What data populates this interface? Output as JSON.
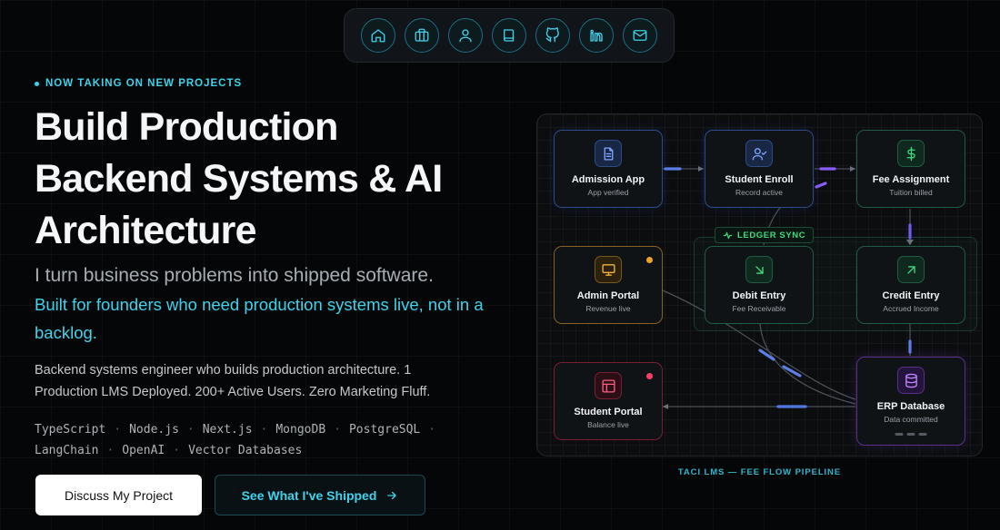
{
  "nav": {
    "items": [
      {
        "name": "home-icon"
      },
      {
        "name": "briefcase-icon"
      },
      {
        "name": "user-icon"
      },
      {
        "name": "book-icon"
      },
      {
        "name": "github-icon"
      },
      {
        "name": "linkedin-icon"
      },
      {
        "name": "mail-icon"
      }
    ]
  },
  "hero": {
    "eyebrow": "NOW TAKING ON NEW PROJECTS",
    "title_line1": "Build Production",
    "title_line2": "Backend Systems & AI",
    "title_line3": "Architecture",
    "subhead": "I turn business problems into shipped software.",
    "subhead_accent": "Built for founders who need production systems live, not in a backlog.",
    "description": "Backend systems engineer who builds production architecture. 1 Production LMS Deployed. 200+ Active Users. Zero Marketing Fluff.",
    "stack": [
      "TypeScript",
      "Node.js",
      "Next.js",
      "MongoDB",
      "PostgreSQL",
      "LangChain",
      "OpenAI",
      "Vector Databases"
    ],
    "primary_button": "Discuss My Project",
    "secondary_button": "See What I've Shipped"
  },
  "diagram": {
    "ledger_tag": "LEDGER SYNC",
    "caption": "TACI LMS — FEE FLOW PIPELINE",
    "nodes": {
      "admission": {
        "title": "Admission App",
        "status": "App verified"
      },
      "enroll": {
        "title": "Student Enroll",
        "status": "Record active"
      },
      "fee": {
        "title": "Fee Assignment",
        "status": "Tuition billed"
      },
      "admin": {
        "title": "Admin Portal",
        "status": "Revenue live"
      },
      "debit": {
        "title": "Debit Entry",
        "status": "Fee Receivable"
      },
      "credit": {
        "title": "Credit Entry",
        "status": "Accrued Income"
      },
      "portal": {
        "title": "Student Portal",
        "status": "Balance live"
      },
      "erp": {
        "title": "ERP Database",
        "status": "Data committed"
      }
    },
    "colors": {
      "accent": "#3fd3ec",
      "blue": "#7fa7ff",
      "green": "#3ddc7f",
      "amber": "#f1b23a",
      "red": "#ff5b7f",
      "purple": "#c084fc"
    }
  }
}
